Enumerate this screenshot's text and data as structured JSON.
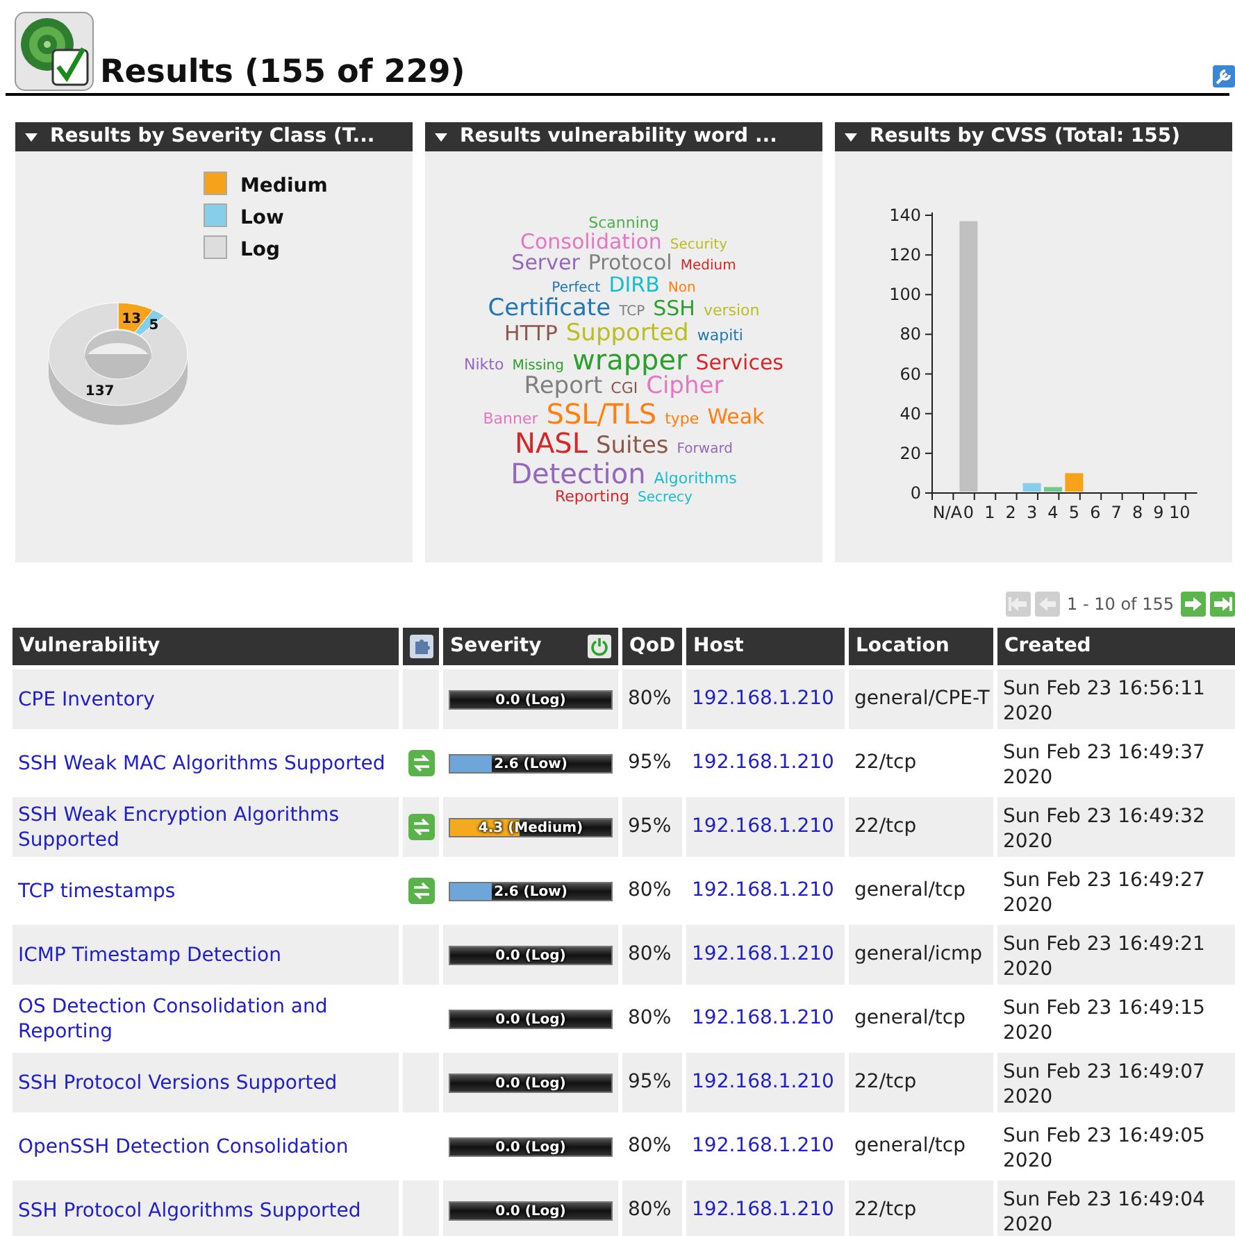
{
  "page": {
    "title": "Results (155 of 229)"
  },
  "panels": [
    {
      "kind": "donut",
      "title": "Results by Severity Class (T...",
      "chart_data": {
        "type": "donut",
        "categories": [
          "Medium",
          "Low",
          "Log"
        ],
        "series": [
          {
            "values": [
              13,
              5,
              137
            ],
            "colors": [
              "#f7a21b",
              "#87ceeb",
              "#dddddd"
            ]
          }
        ],
        "data_labels": true,
        "legend": "right"
      }
    },
    {
      "kind": "cloud",
      "title": "Results vulnerability word ...",
      "rows": [
        [
          {
            "text": "Scanning",
            "color": "#4cae4c",
            "kind": "s"
          }
        ],
        [
          {
            "text": "Consolidation",
            "color": "#e377c2",
            "kind": "m"
          },
          {
            "text": "Security",
            "color": "#bcbd22",
            "kind": "xs"
          }
        ],
        [
          {
            "text": "Server",
            "color": "#9467bd",
            "kind": "m"
          },
          {
            "text": "Protocol",
            "color": "#7f7f7f",
            "kind": "m"
          },
          {
            "text": "Medium",
            "color": "#d62728",
            "kind": "xs"
          }
        ],
        [
          {
            "text": "Perfect",
            "color": "#1f77b4",
            "kind": "xs"
          },
          {
            "text": "DIRB",
            "color": "#17becf",
            "kind": "m"
          },
          {
            "text": "Non",
            "color": "#ff7f0e",
            "kind": "xs"
          }
        ],
        [
          {
            "text": "Certificate",
            "color": "#1f77b4",
            "kind": "l"
          },
          {
            "text": "TCP",
            "color": "#7f7f7f",
            "kind": "xs"
          },
          {
            "text": "SSH",
            "color": "#2ca02c",
            "kind": "m"
          },
          {
            "text": "version",
            "color": "#bcbd22",
            "kind": "s"
          }
        ],
        [
          {
            "text": "HTTP",
            "color": "#8c564b",
            "kind": "m"
          },
          {
            "text": "Supported",
            "color": "#bcbd22",
            "kind": "l"
          },
          {
            "text": "wapiti",
            "color": "#1f77b4",
            "kind": "s"
          }
        ],
        [
          {
            "text": "Nikto",
            "color": "#9467bd",
            "kind": "s"
          },
          {
            "text": "Missing",
            "color": "#2ca02c",
            "kind": "xs"
          },
          {
            "text": "wrapper",
            "color": "#2ca02c",
            "kind": "xl"
          },
          {
            "text": "Services",
            "color": "#d62728",
            "kind": "m"
          }
        ],
        [
          {
            "text": "Report",
            "color": "#7f7f7f",
            "kind": "l"
          },
          {
            "text": "CGI",
            "color": "#8c564b",
            "kind": "s"
          },
          {
            "text": "Cipher",
            "color": "#e377c2",
            "kind": "l"
          }
        ],
        [
          {
            "text": "Banner",
            "color": "#e377c2",
            "kind": "s"
          },
          {
            "text": "SSL/TLS",
            "color": "#ff7f0e",
            "kind": "xl"
          },
          {
            "text": "type",
            "color": "#ff7f0e",
            "kind": "s"
          },
          {
            "text": "Weak",
            "color": "#ff7f0e",
            "kind": "m"
          }
        ],
        [
          {
            "text": "NASL",
            "color": "#d62728",
            "kind": "xl"
          },
          {
            "text": "Suites",
            "color": "#8c564b",
            "kind": "l"
          },
          {
            "text": "Forward",
            "color": "#9467bd",
            "kind": "xs"
          }
        ],
        [
          {
            "text": "Detection",
            "color": "#9467bd",
            "kind": "xl"
          },
          {
            "text": "Algorithms",
            "color": "#17becf",
            "kind": "s"
          }
        ],
        [
          {
            "text": "Reporting",
            "color": "#d62728",
            "kind": "s"
          },
          {
            "text": "Secrecy",
            "color": "#17becf",
            "kind": "xs"
          }
        ]
      ]
    },
    {
      "kind": "bars",
      "title": "Results by CVSS (Total: 155)",
      "chart_data": {
        "type": "bar",
        "categories": [
          "N/A",
          "0",
          "1",
          "2",
          "3",
          "4",
          "5",
          "6",
          "7",
          "8",
          "9",
          "10"
        ],
        "series": [
          {
            "values": [
              0,
              137,
              0,
              0,
              5,
              3,
              10,
              0,
              0,
              0,
              0,
              0
            ],
            "colors": [
              null,
              "#c0c0c0",
              null,
              null,
              "#87ceeb",
              "#70c98a",
              "#f7a21b",
              null,
              null,
              null,
              null,
              null
            ]
          }
        ],
        "ylim": [
          0,
          140
        ],
        "yticks": [
          0,
          20,
          40,
          60,
          80,
          100,
          120,
          140
        ]
      }
    }
  ],
  "pagination": {
    "label": "1 - 10 of 155",
    "buttons": [
      {
        "kind": "first",
        "disabled": true
      },
      {
        "kind": "prev",
        "disabled": true
      },
      {
        "kind": "next",
        "disabled": false
      },
      {
        "kind": "last",
        "disabled": false
      }
    ]
  },
  "table": {
    "columns": [
      "Vulnerability",
      "",
      "Severity",
      "QoD",
      "Host",
      "Location",
      "Created"
    ],
    "rows": [
      {
        "vulnerability": "CPE Inventory",
        "solution": false,
        "severity": "0.0 (Log)",
        "qod": "80%",
        "host": "192.168.1.210",
        "location": "general/CPE-T",
        "created": "Sun Feb 23 16:56:11 2020"
      },
      {
        "vulnerability": "SSH Weak MAC Algorithms Supported",
        "solution": true,
        "severity": "2.6 (Low)",
        "kind": "low",
        "level": 0.26,
        "qod": "95%",
        "host": "192.168.1.210",
        "location": "22/tcp",
        "created": "Sun Feb 23 16:49:37 2020"
      },
      {
        "vulnerability": "SSH Weak Encryption Algorithms Supported",
        "solution": true,
        "severity": "4.3 (Medium)",
        "kind": "medium",
        "level": 0.43,
        "qod": "95%",
        "host": "192.168.1.210",
        "location": "22/tcp",
        "created": "Sun Feb 23 16:49:32 2020"
      },
      {
        "vulnerability": "TCP timestamps",
        "solution": true,
        "severity": "2.6 (Low)",
        "kind": "low",
        "level": 0.26,
        "qod": "80%",
        "host": "192.168.1.210",
        "location": "general/tcp",
        "created": "Sun Feb 23 16:49:27 2020"
      },
      {
        "vulnerability": "ICMP Timestamp Detection",
        "solution": false,
        "severity": "0.0 (Log)",
        "qod": "80%",
        "host": "192.168.1.210",
        "location": "general/icmp",
        "created": "Sun Feb 23 16:49:21 2020"
      },
      {
        "vulnerability": "OS Detection Consolidation and Reporting",
        "solution": false,
        "severity": "0.0 (Log)",
        "qod": "80%",
        "host": "192.168.1.210",
        "location": "general/tcp",
        "created": "Sun Feb 23 16:49:15 2020"
      },
      {
        "vulnerability": "SSH Protocol Versions Supported",
        "solution": false,
        "severity": "0.0 (Log)",
        "qod": "95%",
        "host": "192.168.1.210",
        "location": "22/tcp",
        "created": "Sun Feb 23 16:49:07 2020"
      },
      {
        "vulnerability": "OpenSSH Detection Consolidation",
        "solution": false,
        "severity": "0.0 (Log)",
        "qod": "80%",
        "host": "192.168.1.210",
        "location": "general/tcp",
        "created": "Sun Feb 23 16:49:05 2020"
      },
      {
        "vulnerability": "SSH Protocol Algorithms Supported",
        "solution": false,
        "severity": "0.0 (Log)",
        "qod": "80%",
        "host": "192.168.1.210",
        "location": "22/tcp",
        "created": "Sun Feb 23 16:49:04 2020"
      }
    ]
  }
}
